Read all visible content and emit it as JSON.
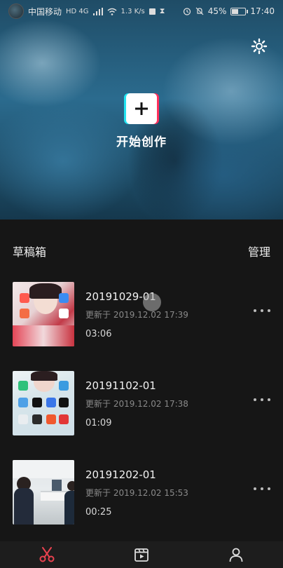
{
  "status_bar": {
    "carrier": "中国移动",
    "network": "HD 4G",
    "speed": "1.3 K/s",
    "battery": "45%",
    "battery_level": 0.45,
    "time": "17:40"
  },
  "hero": {
    "create_label": "开始创作",
    "create_icon": "plus-icon",
    "settings_icon": "gear-icon"
  },
  "drafts": {
    "header": "草稿箱",
    "manage": "管理",
    "items": [
      {
        "title": "20191029-01",
        "updated": "更新于 2019.12.02 17:39",
        "duration": "03:06"
      },
      {
        "title": "20191102-01",
        "updated": "更新于 2019.12.02 17:38",
        "duration": "01:09"
      },
      {
        "title": "20191202-01",
        "updated": "更新于 2019.12.02 15:53",
        "duration": "00:25"
      }
    ]
  },
  "nav": {
    "items": [
      {
        "icon": "scissors-icon",
        "active": true
      },
      {
        "icon": "template-icon",
        "active": false
      },
      {
        "icon": "profile-icon",
        "active": false
      }
    ],
    "accent": "#e8424f"
  }
}
